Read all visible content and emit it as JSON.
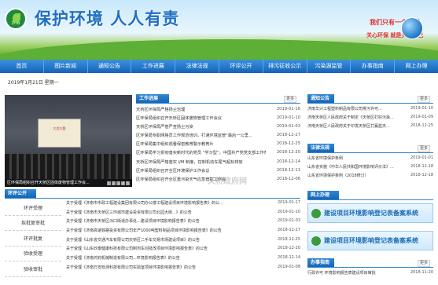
{
  "header": {
    "title": "保护环境 人人有责",
    "logo_text": "ZHB",
    "slogan1": "我们只有一个地球",
    "slogan2": "关心环保 就是关心自己"
  },
  "nav": [
    "首页",
    "图片新闻",
    "通知公告",
    "工作进展",
    "法律法规",
    "环评公开",
    "排污征收公示",
    "污染源监管",
    "办事指南",
    "网上办理"
  ],
  "date": "2019年1月21日 星期一",
  "slide": {
    "screen_text": "大会主题",
    "caption": "区环保局组织召开天桥区固体废物管理工作会...",
    "dots": [
      "1",
      "2",
      "3",
      "4",
      "5"
    ]
  },
  "work": {
    "title": "工作进展",
    "more": "更多",
    "items": [
      {
        "t": "天桥区环保局严格扬尘治理",
        "d": "2019-01-16"
      },
      {
        "t": "区环保局组织召开天桥区固体废物管理工作会议",
        "d": "2019-01-10"
      },
      {
        "t": "天桥区环保局严管严查扬尘污染",
        "d": "2019-01-03"
      },
      {
        "t": "区环保局专职网格员工作规范培训，打通环境监管“最后一公里...",
        "d": "2018-12-27"
      },
      {
        "t": "区环保局集中组织观看保密教育警示教育片",
        "d": "2018-12-25"
      },
      {
        "t": "区环保局学习贯彻落实新时代的党员 “学习型”，中国共产党党支部工作条例...",
        "d": "2018-12-20"
      },
      {
        "t": "天桥区环保局严格落实 I/M 制度，控制机动车尾气超标排放",
        "d": "2018-12-14"
      },
      {
        "t": "区环保局组织召开全区环境保护工作会议",
        "d": "2018-12-11"
      },
      {
        "t": "区环保局组织召开全区重污染天气应急管控工作会",
        "d": "2018-12-06"
      }
    ]
  },
  "notice": {
    "title": "通知公告",
    "more": "更多",
    "items": [
      {
        "t": "济南华兴工程塑料制品有限公司排污许可...",
        "d": "2019-01-10"
      },
      {
        "t": "济南天桥区人民政府关于制定《天桥区打好污染...",
        "d": "2019-01-09"
      },
      {
        "t": "济南天桥区人民政府关于印发天桥区打赢蓝天...",
        "d": "2018-12-25"
      }
    ]
  },
  "law": {
    "title": "法律法规",
    "more": "更多",
    "items": [
      {
        "t": "山东省环境保护条例",
        "d": "2019-01-01"
      },
      {
        "t": "山东省实施《中华人民共和国环境影响评价法》...",
        "d": "2018-12-18"
      },
      {
        "t": "山东省环境保护条例（2018修订）",
        "d": "2018-12-18"
      }
    ]
  },
  "online": {
    "title": "网上办理"
  },
  "banners": [
    "建设项目环境影响登记表备案系统",
    "建设项目环境影响登记表备案系统"
  ],
  "guide": {
    "title": "办事指南",
    "more": "更多",
    "items": [
      {
        "t": "行政许可 环境影响报告表建设项目审批",
        "d": "2018-11-20"
      }
    ]
  },
  "env": {
    "title": "环评公开",
    "side": [
      "环评受理",
      "拟批复审批",
      "环评批复",
      "验收受理",
      "验收审批"
    ],
    "items": [
      {
        "t": "关于受理《济南市市政工程建设集团有限公司办公楼工程建设项目环境影响报告表》的公...",
        "d": "2019-01-17"
      },
      {
        "t": "关于受理《济南市天桥区三环城市建设投资有限公司北园大街...》的公告",
        "d": "2019-01-10"
      },
      {
        "t": "关于受理《济南市天桥区泺口街道办事处...建设项目环境影响报告表》的公告",
        "d": "2019-01-03"
      },
      {
        "t": "关于受理《济南高速铁路投资有限公司年产1000吨塑料制品项目环境影响报告表》的公告",
        "d": "2018-12-27"
      },
      {
        "t": "关于受理《山东省交通汽车有限公司天桥区二手车交易市场建设项目》的公告",
        "d": "2018-12-25"
      },
      {
        "t": "关于受理《山东欣泰健康科技有限公司制剂车间技改项目环境影响报告表》的公告",
        "d": "2018-12-20"
      },
      {
        "t": "关于受理《济南鸿钧机械制造有限公司...环境影响报告表》的公告",
        "d": "2018-12-14"
      },
      {
        "t": "关于受理《济南万安检测科技有限公司实验室项目环境影响报告表》的公告",
        "d": "2019-01-08"
      }
    ]
  },
  "watermark": "天桥政府网"
}
